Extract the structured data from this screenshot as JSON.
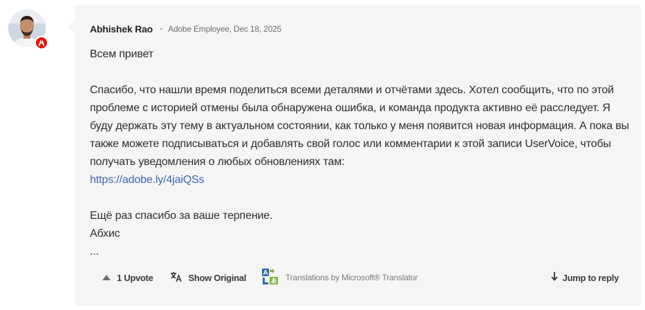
{
  "post": {
    "author": "Abhishek Rao",
    "separator": "•",
    "role_date": "Adobe Employee, Dec 18, 2025",
    "body": {
      "greeting": "Всем привет",
      "p1_text": "Спасибо, что нашли время поделиться всеми деталями и отчётами здесь. Хотел сообщить, что по этой проблеме с историей отмены была обнаружена ошибка, и команда продукта активно её расследует. Я буду держать эту тему в актуальном состоянии, как только у меня появится новая информация. А пока вы также можете подписываться и добавлять свой голос или комментарии к этой записи ",
      "p1_link": "UserVoice",
      "p1_text_after": ", чтобы получать уведомления о любых обновлениях там:",
      "short_url": "https://adobe.ly/4jaiQSs",
      "thanks": "Ещё раз спасибо за ваше терпение.",
      "signature": "Абхис",
      "ellipsis": "..."
    }
  },
  "actions": {
    "upvote_label": "1 Upvote",
    "show_original_label": "Show Original",
    "translations_label": "Translations by Microsoft® Translator",
    "jump_label": "Jump to reply"
  },
  "icons": {
    "upvote": "upvote-triangle-icon",
    "translate": "translate-icon",
    "microsoft_translator": "microsoft-translator-icon",
    "jump": "arrow-down-icon",
    "badge": "adobe-badge-icon"
  },
  "colors": {
    "card_bg": "#f5f5f5",
    "link": "#3b63b3",
    "adobe_red": "#eb1000"
  }
}
